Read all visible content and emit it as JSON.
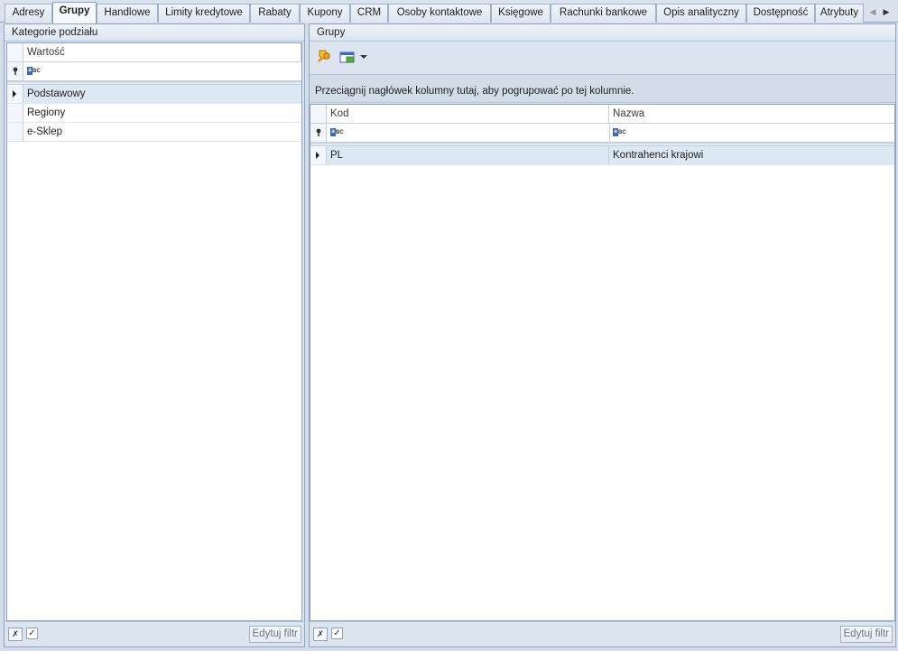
{
  "tabs": [
    {
      "label": "Adresy",
      "active": false
    },
    {
      "label": "Grupy",
      "active": true
    },
    {
      "label": "Handlowe",
      "active": false
    },
    {
      "label": "Limity kredytowe",
      "active": false
    },
    {
      "label": "Rabaty",
      "active": false
    },
    {
      "label": "Kupony",
      "active": false
    },
    {
      "label": "CRM",
      "active": false
    },
    {
      "label": "Osoby kontaktowe",
      "active": false
    },
    {
      "label": "Księgowe",
      "active": false
    },
    {
      "label": "Rachunki bankowe",
      "active": false
    },
    {
      "label": "Opis analityczny",
      "active": false
    },
    {
      "label": "Dostępność",
      "active": false
    },
    {
      "label": "Atrybuty",
      "active": false
    }
  ],
  "left_panel": {
    "title": "Kategorie podziału",
    "column_header": "Wartość",
    "filter_icon": "abc-filter-icon",
    "rows": [
      "Podstawowy",
      "Regiony",
      "e-Sklep"
    ],
    "selected_row": 0,
    "footer": {
      "edit_filter_label": "Edytuj filtr",
      "clear_icon": "clear-filter-icon",
      "checkbox_checked": true
    }
  },
  "right_panel": {
    "title": "Grupy",
    "toolbar": {
      "icons": [
        "add-group-icon",
        "grid-settings-icon",
        "dropdown-arrow-icon"
      ]
    },
    "group_hint": "Przeciągnij nagłówek kolumny tutaj, aby pogrupować po tej kolumnie.",
    "columns": [
      "Kod",
      "Nazwa"
    ],
    "rows": [
      {
        "kod": "PL",
        "nazwa": "Kontrahenci krajowi"
      }
    ],
    "footer": {
      "edit_filter_label": "Edytuj filtr",
      "clear_icon": "clear-filter-icon",
      "checkbox_checked": true
    }
  },
  "colors": {
    "accent": "#3e6ab3",
    "selected_row": "#dde8f5",
    "border": "#8ea3bf"
  }
}
